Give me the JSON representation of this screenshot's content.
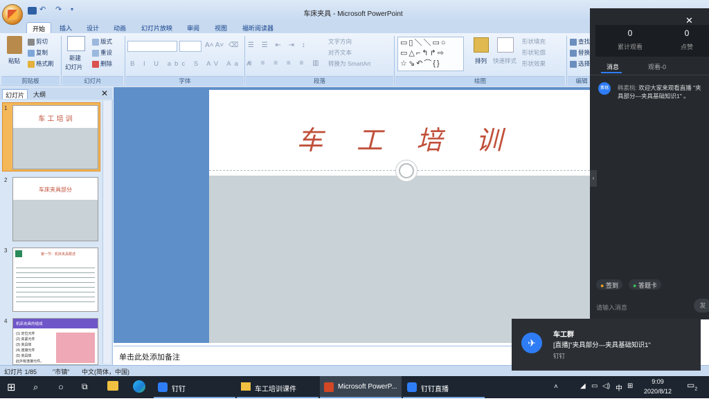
{
  "window": {
    "title": "车床夹具 - Microsoft PowerPoint"
  },
  "tabs": [
    "开始",
    "插入",
    "设计",
    "动画",
    "幻灯片放映",
    "审阅",
    "视图",
    "福昕阅读器"
  ],
  "ribbon": {
    "clipboard": {
      "paste": "粘贴",
      "cut": "剪切",
      "copy": "复制",
      "format_painter": "格式刷",
      "label": "剪贴板"
    },
    "slides": {
      "new_slide": "新建",
      "new_slide2": "幻灯片",
      "layout": "版式",
      "reset": "重设",
      "delete": "删除",
      "label": "幻灯片"
    },
    "font": {
      "label": "字体"
    },
    "paragraph": {
      "text_direction": "文字方向",
      "align_text": "对齐文本",
      "smartart": "转换为 SmartArt",
      "label": "段落"
    },
    "drawing": {
      "arrange": "排列",
      "quick_styles": "快速样式",
      "shape_fill": "形状填充",
      "shape_outline": "形状轮廓",
      "shape_effects": "形状效果",
      "label": "绘图"
    },
    "editing": {
      "find": "查找",
      "replace": "替换",
      "select": "选择",
      "label": "编辑"
    }
  },
  "left_panel": {
    "tabs": [
      "幻灯片",
      "大纲"
    ],
    "slides": [
      {
        "num": "1",
        "title": "车 工 培 训"
      },
      {
        "num": "2",
        "title": "车床夹具部分"
      },
      {
        "num": "3",
        "title": "第一节：机床夹具概述"
      },
      {
        "num": "4",
        "title": "机床夹具的组成",
        "lines": [
          "(1) 定位元件",
          "(2) 夹紧元件",
          "(3) 夹具体",
          "(4) 连接元件",
          "(5) 夹具体",
          "此外有连接元件。"
        ]
      }
    ]
  },
  "slide": {
    "title": "车    工    培    训"
  },
  "notes": {
    "placeholder": "单击此处添加备注"
  },
  "status": {
    "slide": "幻灯片 1/85",
    "theme": "\"市镇\"",
    "lang": "中文(简体，中国)"
  },
  "ding": {
    "total_views_value": "0",
    "total_views_label": "累计观看",
    "likes_value": "0",
    "likes_label": "点赞",
    "tab_messages": "消息",
    "tab_viewers": "观看-0",
    "message_avatar": "素桃",
    "message_user": "韩素桃:",
    "message_text": "欢迎大家来观看直播  \"夹具部分—夹具基础知识1\" 。",
    "signin": "签到",
    "question_card": "答题卡",
    "input_placeholder": "请输入消息",
    "send": "发"
  },
  "toast": {
    "group": "车工群",
    "message": "[直播]\"夹具部分—夹具基础知识1\"",
    "app": "钉钉"
  },
  "taskbar": {
    "items": [
      "钉钉",
      "车工培训课件",
      "Microsoft PowerP...",
      "钉钉直播"
    ],
    "ime": "中",
    "time": "9:09",
    "date": "2020/8/12",
    "notif_count": "2"
  },
  "colors": {
    "accent_red": "#c0503a",
    "ribbon_blue": "#c8daf0",
    "slide_gray": "#c9d2d6"
  }
}
